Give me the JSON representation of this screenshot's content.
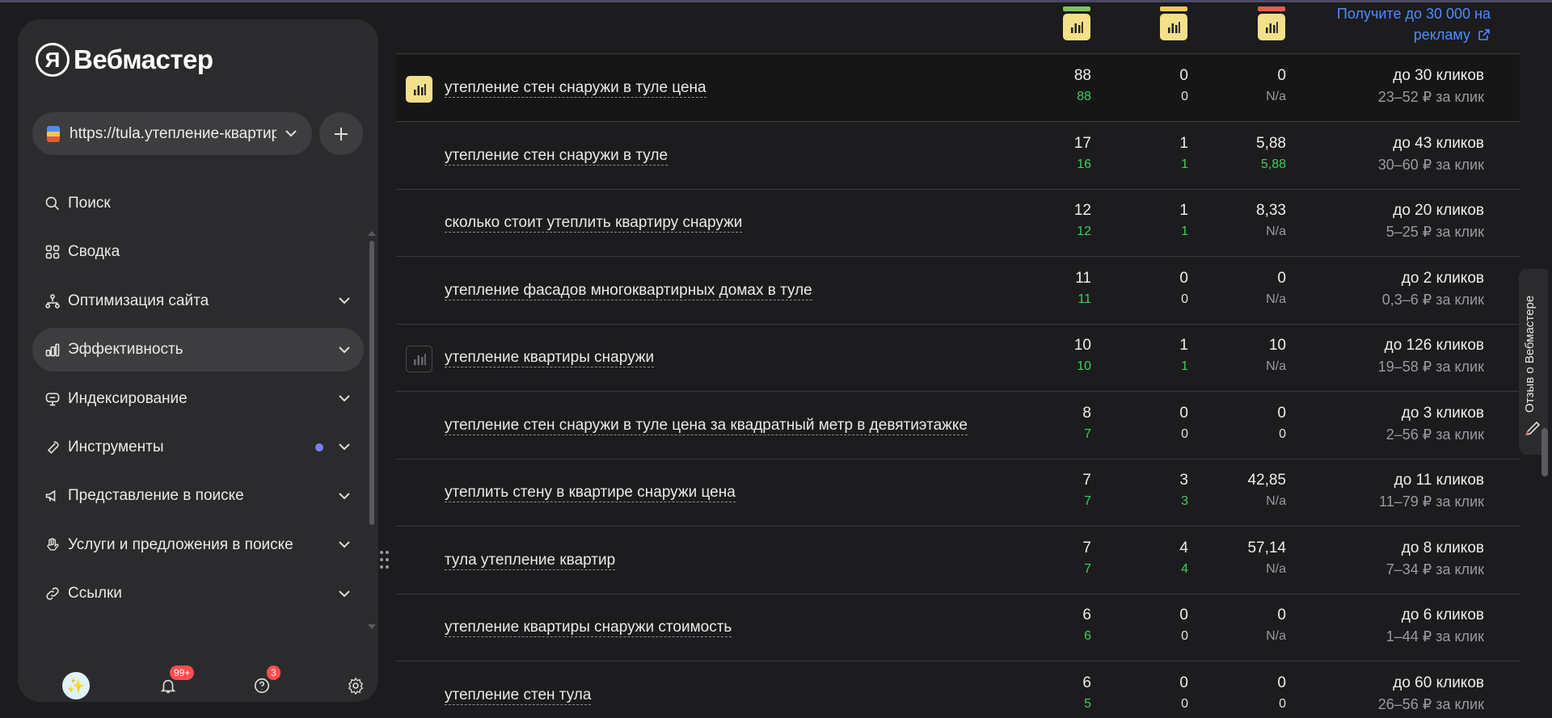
{
  "logo": {
    "mark": "Я",
    "text": "Вебмастер"
  },
  "site": {
    "url": "https://tula.утепление-квартир"
  },
  "nav": [
    {
      "label": "Поиск",
      "icon": "search-icon",
      "chevron": false
    },
    {
      "label": "Сводка",
      "icon": "grid-icon",
      "chevron": false
    },
    {
      "label": "Оптимизация сайта",
      "icon": "structure-icon",
      "chevron": true
    },
    {
      "label": "Эффективность",
      "icon": "bar-chart-icon",
      "chevron": true,
      "active": true
    },
    {
      "label": "Индексирование",
      "icon": "brain-icon",
      "chevron": true
    },
    {
      "label": "Инструменты",
      "icon": "wrench-icon",
      "chevron": true,
      "dot": true
    },
    {
      "label": "Представление в поиске",
      "icon": "megaphone-icon",
      "chevron": true
    },
    {
      "label": "Услуги и предложения в поиске",
      "icon": "hand-icon",
      "chevron": true
    },
    {
      "label": "Ссылки",
      "icon": "link-icon",
      "chevron": true
    }
  ],
  "footer": {
    "notifications_badge": "99+",
    "help_badge": "3"
  },
  "header": {
    "bar_colors": [
      "#7ac55a",
      "#f2c94c",
      "#f05a4a"
    ],
    "promo_line1": "Получите до 30 000 на",
    "promo_line2": "рекламу"
  },
  "rows": [
    {
      "query": "утепление стен снаружи в туле цена",
      "icon": "yellow",
      "c1": "88",
      "c1s": "88",
      "c1t": "g",
      "c2": "0",
      "c2s": "0",
      "c2t": "p",
      "c3": "0",
      "c3s": "N/a",
      "c3t": "n",
      "clicks": "до 30 кликов",
      "price": "23–52 ₽ за клик"
    },
    {
      "query": "утепление стен снаружи в туле",
      "icon": "",
      "c1": "17",
      "c1s": "16",
      "c1t": "g",
      "c2": "1",
      "c2s": "1",
      "c2t": "g",
      "c3": "5,88",
      "c3s": "5,88",
      "c3t": "g",
      "clicks": "до 43 кликов",
      "price": "30–60 ₽ за клик"
    },
    {
      "query": "сколько стоит утеплить квартиру снаружи",
      "icon": "",
      "c1": "12",
      "c1s": "12",
      "c1t": "g",
      "c2": "1",
      "c2s": "1",
      "c2t": "g",
      "c3": "8,33",
      "c3s": "N/a",
      "c3t": "n",
      "clicks": "до 20 кликов",
      "price": "5–25 ₽ за клик"
    },
    {
      "query": "утепление фасадов многоквартирных домах в туле",
      "icon": "",
      "c1": "11",
      "c1s": "11",
      "c1t": "g",
      "c2": "0",
      "c2s": "0",
      "c2t": "p",
      "c3": "0",
      "c3s": "N/a",
      "c3t": "n",
      "clicks": "до 2 кликов",
      "price": "0,3–6 ₽ за клик"
    },
    {
      "query": "утепление квартиры снаружи",
      "icon": "outline",
      "c1": "10",
      "c1s": "10",
      "c1t": "g",
      "c2": "1",
      "c2s": "1",
      "c2t": "g",
      "c3": "10",
      "c3s": "N/a",
      "c3t": "n",
      "clicks": "до 126 кликов",
      "price": "19–58 ₽ за клик"
    },
    {
      "query": "утепление стен снаружи в туле цена за квадратный метр в девятиэтажке",
      "icon": "",
      "c1": "8",
      "c1s": "7",
      "c1t": "g",
      "c2": "0",
      "c2s": "0",
      "c2t": "p",
      "c3": "0",
      "c3s": "0",
      "c3t": "p",
      "clicks": "до 3 кликов",
      "price": "2–56 ₽ за клик"
    },
    {
      "query": "утеплить стену в квартире снаружи цена",
      "icon": "",
      "c1": "7",
      "c1s": "7",
      "c1t": "g",
      "c2": "3",
      "c2s": "3",
      "c2t": "g",
      "c3": "42,85",
      "c3s": "N/a",
      "c3t": "n",
      "clicks": "до 11 кликов",
      "price": "11–79 ₽ за клик"
    },
    {
      "query": "тула утепление квартир",
      "icon": "",
      "c1": "7",
      "c1s": "7",
      "c1t": "g",
      "c2": "4",
      "c2s": "4",
      "c2t": "g",
      "c3": "57,14",
      "c3s": "N/a",
      "c3t": "n",
      "clicks": "до 8 кликов",
      "price": "7–34 ₽ за клик"
    },
    {
      "query": "утепление квартиры снаружи стоимость",
      "icon": "",
      "c1": "6",
      "c1s": "6",
      "c1t": "g",
      "c2": "0",
      "c2s": "0",
      "c2t": "p",
      "c3": "0",
      "c3s": "N/a",
      "c3t": "n",
      "clicks": "до 6 кликов",
      "price": "1–44 ₽ за клик"
    },
    {
      "query": "утепление стен тула",
      "icon": "",
      "c1": "6",
      "c1s": "5",
      "c1t": "g",
      "c2": "0",
      "c2s": "0",
      "c2t": "p",
      "c3": "0",
      "c3s": "0",
      "c3t": "p",
      "clicks": "до 60 кликов",
      "price": "26–56 ₽ за клик"
    }
  ],
  "feedback": {
    "label": "Отзыв о Вебмастере"
  }
}
